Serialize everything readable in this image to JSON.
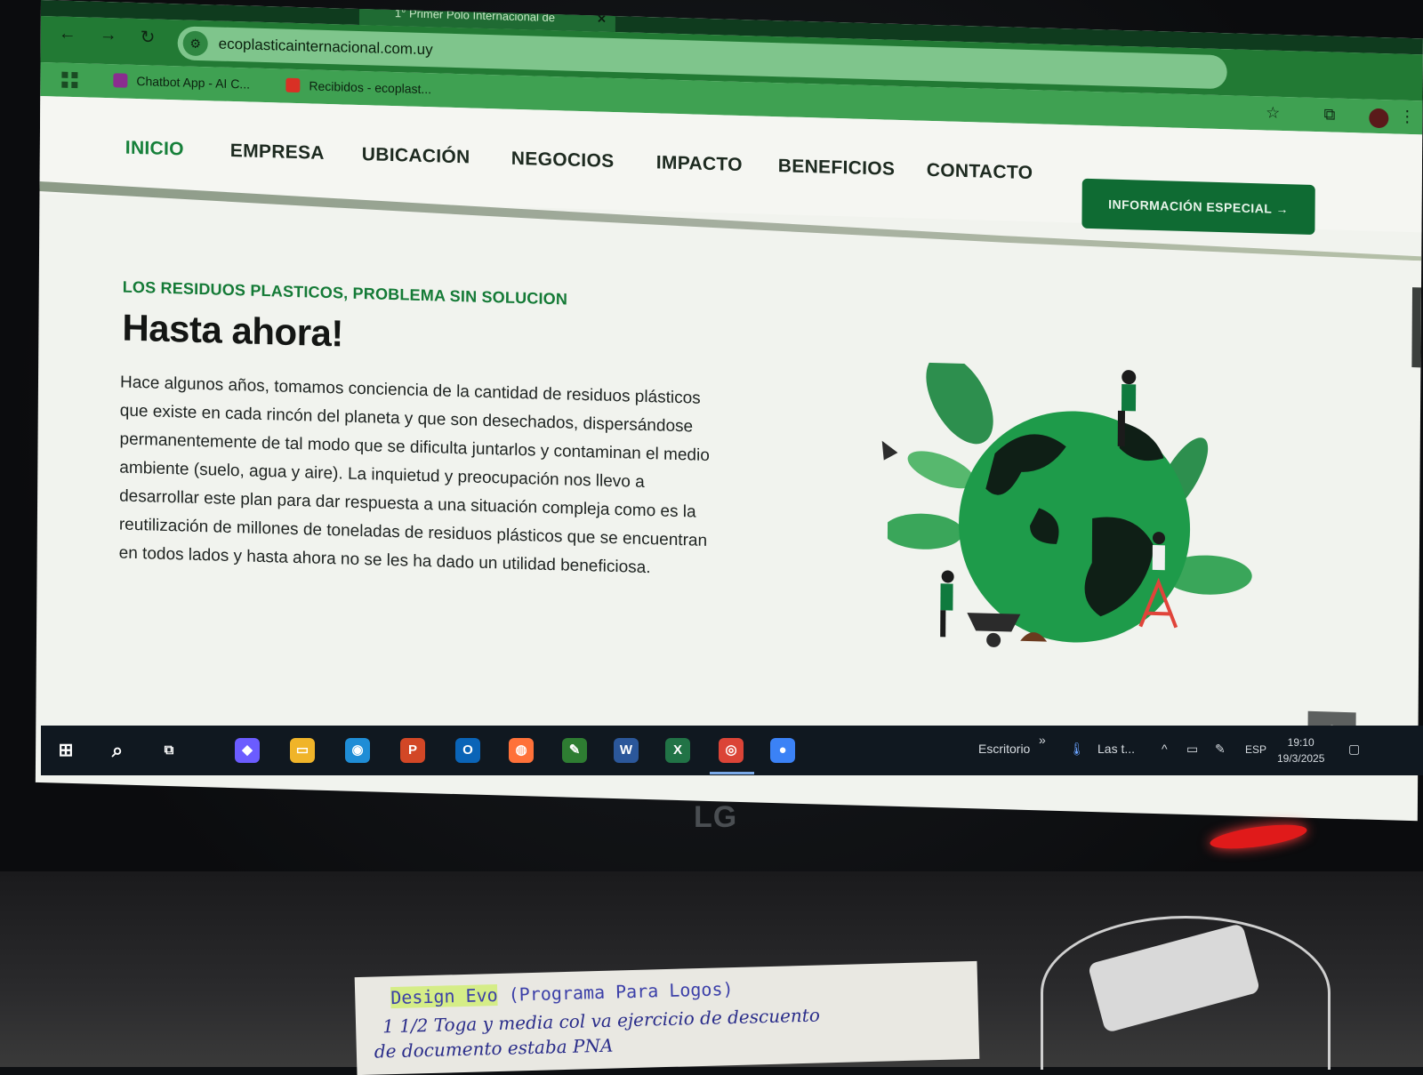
{
  "browser": {
    "tab_title": "1° Primer Polo Internacional de",
    "tab_close": "✕",
    "url": "ecoplasticainternacional.com.uy",
    "bookmarks": [
      {
        "label": "Chatbot App - AI C...",
        "color": "#8a2d8f"
      },
      {
        "label": "Recibidos - ecoplast...",
        "color": "#d93025"
      }
    ]
  },
  "site": {
    "nav": [
      "INICIO",
      "EMPRESA",
      "UBICACIÓN",
      "NEGOCIOS",
      "IMPACTO",
      "BENEFICIOS",
      "CONTACTO"
    ],
    "cta_label": "INFORMACIÓN ESPECIAL →",
    "hero": {
      "eyebrow": "LOS RESIDUOS PLASTICOS, PROBLEMA SIN SOLUCION",
      "headline": "Hasta ahora!",
      "paragraph": "Hace algunos años, tomamos conciencia de la cantidad de residuos plásticos que existe en cada rincón del planeta y que son desechados, dispersándose permanentemente de tal modo que se dificulta juntarlos y contaminan el medio ambiente (suelo, agua y aire). La inquietud y preocupación nos llevo a desarrollar este plan para dar respuesta a una situación compleja como es la reutilización de millones de toneladas de residuos plásticos que se encuentran en todos lados y hasta ahora no se les ha dado un utilidad beneficiosa."
    },
    "scroll_top_label": "^",
    "accent_color": "#16803a"
  },
  "taskbar": {
    "search_icon": "⌕",
    "taskview_icon": "⧉",
    "apps": [
      {
        "name": "copilot",
        "glyph": "◆",
        "color": "#6b5cff"
      },
      {
        "name": "explorer",
        "glyph": "▭",
        "color": "#f0b429"
      },
      {
        "name": "edge",
        "glyph": "◉",
        "color": "#1f8dd6"
      },
      {
        "name": "powerpoint",
        "glyph": "P",
        "color": "#d24726"
      },
      {
        "name": "outlook",
        "glyph": "O",
        "color": "#0a64b7"
      },
      {
        "name": "firefox",
        "glyph": "◍",
        "color": "#ff7139"
      },
      {
        "name": "app",
        "glyph": "✎",
        "color": "#2e7d32"
      },
      {
        "name": "word",
        "glyph": "W",
        "color": "#2b579a"
      },
      {
        "name": "excel",
        "glyph": "X",
        "color": "#217346"
      },
      {
        "name": "chrome",
        "glyph": "◎",
        "color": "#db4437"
      },
      {
        "name": "app2",
        "glyph": "●",
        "color": "#3b82f6"
      }
    ],
    "desktop_label": "Escritorio",
    "weather_label": "Las t...",
    "language": "ESP",
    "time": "19:10",
    "date": "19/3/2025"
  },
  "physical": {
    "monitor_brand": "LG",
    "note": {
      "line1_highlight": "Design Evo",
      "line1_rest": " (Programa Para Logos)",
      "line2": "1 1/2 Toga y media col va ejercicio de descuento",
      "line3": "de documento estaba PNA"
    }
  }
}
